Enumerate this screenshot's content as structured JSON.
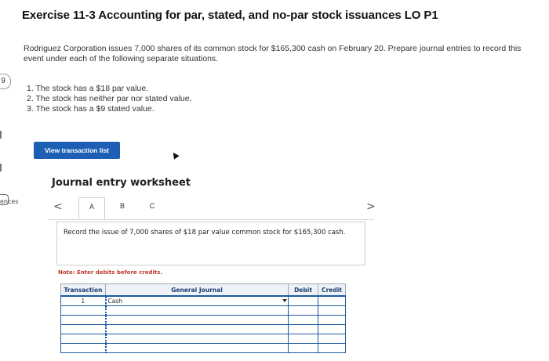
{
  "exercise": {
    "title": "Exercise 11-3 Accounting for par, stated, and no-par stock issuances LO P1",
    "intro": "Rodriguez Corporation issues 7,000 shares of its common stock for $165,300 cash on February 20. Prepare journal entries to record this event under each of the following separate situations.",
    "requirements": [
      "1. The stock has a $18 par value.",
      "2. The stock has neither par nor stated value.",
      "3. The stock has a $9 stated value."
    ]
  },
  "left_strip": {
    "badge": "9",
    "ref_label": "ences"
  },
  "view_transactions_label": "View transaction list",
  "worksheet": {
    "title": "Journal entry worksheet",
    "nav_prev": "<",
    "nav_next": ">",
    "tabs": [
      "A",
      "B",
      "C"
    ],
    "active_tab": "A",
    "instruction": "Record the issue of 7,000 shares of $18 par value common stock for $165,300 cash.",
    "note": "Note: Enter debits before credits.",
    "table": {
      "headers": [
        "Transaction",
        "General Journal",
        "Debit",
        "Credit"
      ],
      "rows": [
        {
          "transaction": "1",
          "account": "Cash",
          "debit": "",
          "credit": ""
        },
        {
          "transaction": "",
          "account": "",
          "debit": "",
          "credit": ""
        },
        {
          "transaction": "",
          "account": "",
          "debit": "",
          "credit": ""
        },
        {
          "transaction": "",
          "account": "",
          "debit": "",
          "credit": ""
        },
        {
          "transaction": "",
          "account": "",
          "debit": "",
          "credit": ""
        },
        {
          "transaction": "",
          "account": "",
          "debit": "",
          "credit": ""
        }
      ]
    }
  },
  "colors": {
    "button_bg": "#1d5fb4",
    "note_text": "#c0392b",
    "table_border": "#1b5aa0"
  }
}
